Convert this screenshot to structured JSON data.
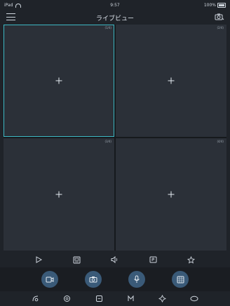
{
  "status_bar": {
    "carrier": "iPad",
    "time": "9:57",
    "battery": "100%",
    "battery_level": 1.0
  },
  "header": {
    "title": "ライブビュー",
    "menu_icon": "hamburger-menu-icon",
    "settings_icon": "camera-settings-icon"
  },
  "grid": {
    "cells": [
      {
        "label": "(1/4)",
        "selected": true
      },
      {
        "label": "(2/4)",
        "selected": false
      },
      {
        "label": "(3/4)",
        "selected": false
      },
      {
        "label": "(4/4)",
        "selected": false
      }
    ]
  },
  "toolbar": {
    "icons": [
      "play-icon",
      "layout-icon",
      "sound-icon",
      "stream-icon",
      "favorite-icon"
    ]
  },
  "actions": {
    "icons": [
      "record-icon",
      "snapshot-icon",
      "microphone-icon",
      "playback-icon"
    ],
    "button_color": "#3a5a78"
  },
  "bottom_nav": {
    "icons": [
      "ptz-icon",
      "focus-icon",
      "zoom-icon",
      "scene-icon",
      "preset-icon",
      "cruise-icon"
    ]
  },
  "colors": {
    "background": "#1f2329",
    "cell": "#2b3038",
    "selected_border": "#3db8c4",
    "icon": "#cfd6de"
  }
}
